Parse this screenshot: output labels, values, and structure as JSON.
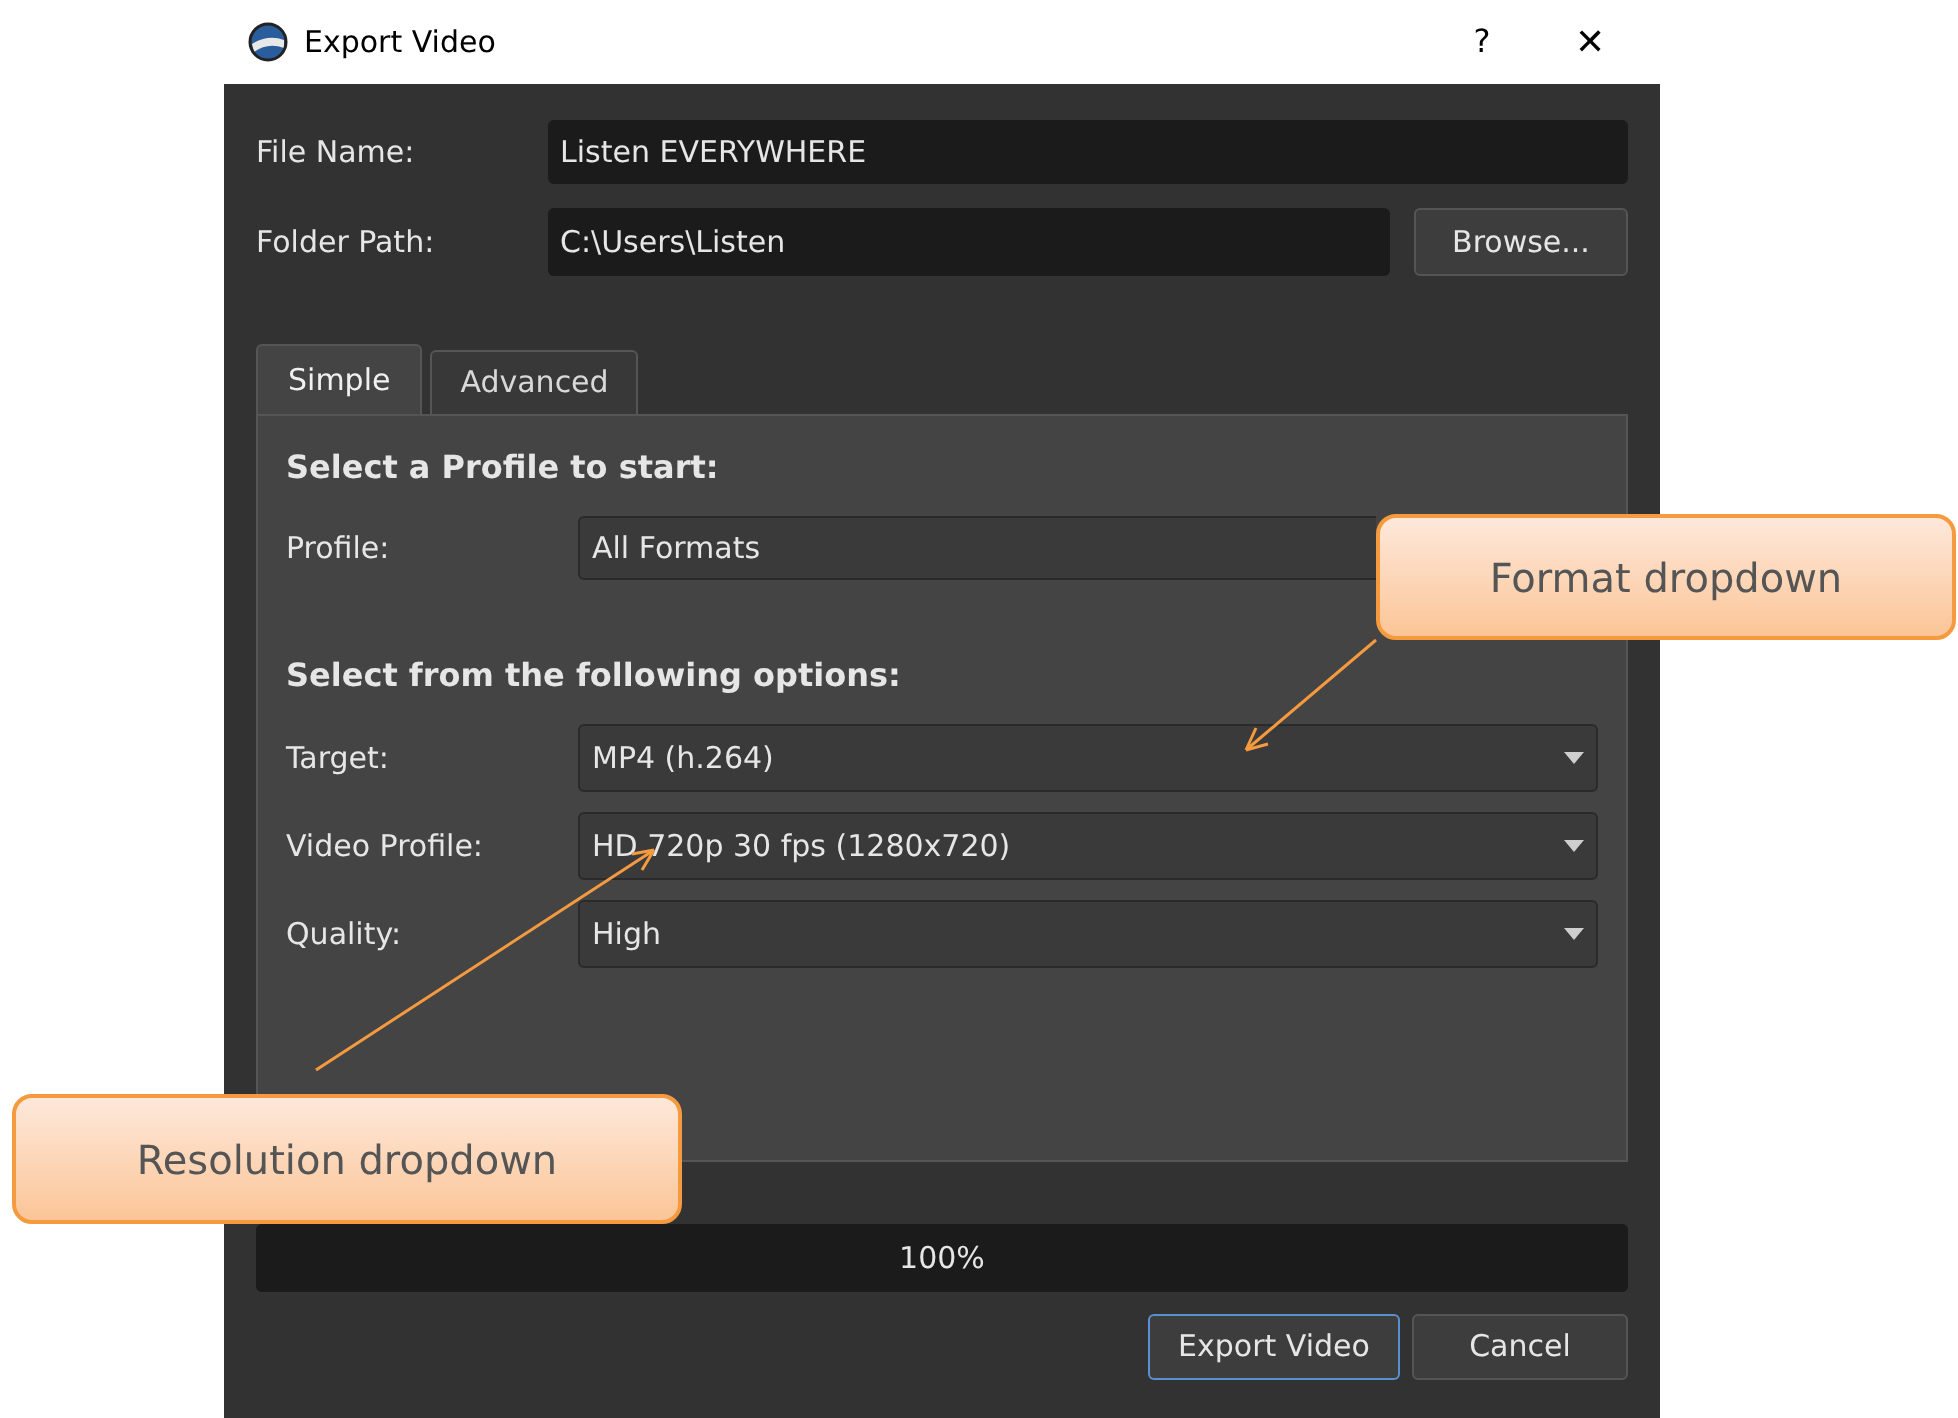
{
  "window": {
    "title": "Export Video",
    "help": "?",
    "close": "✕"
  },
  "file_name": {
    "label": "File Name:",
    "value": "Listen EVERYWHERE"
  },
  "folder_path": {
    "label": "Folder Path:",
    "value": "C:\\Users\\Listen",
    "browse": "Browse..."
  },
  "tabs": [
    {
      "label": "Simple",
      "selected": true
    },
    {
      "label": "Advanced",
      "selected": false
    }
  ],
  "profile_heading": "Select a Profile to start:",
  "profile": {
    "label": "Profile:",
    "value": "All Formats"
  },
  "options_heading": "Select from the following options:",
  "options": [
    {
      "label": "Target:",
      "value": "MP4 (h.264)"
    },
    {
      "label": "Video Profile:",
      "value": "HD 720p 30 fps (1280x720)"
    },
    {
      "label": "Quality:",
      "value": "High"
    }
  ],
  "progress": {
    "text": "100%",
    "level": 1
  },
  "buttons": [
    {
      "label": "Export Video",
      "default": true
    },
    {
      "label": "Cancel",
      "default": false
    }
  ],
  "callouts": [
    {
      "text": "Format dropdown"
    },
    {
      "text": "Resolution dropdown"
    }
  ]
}
